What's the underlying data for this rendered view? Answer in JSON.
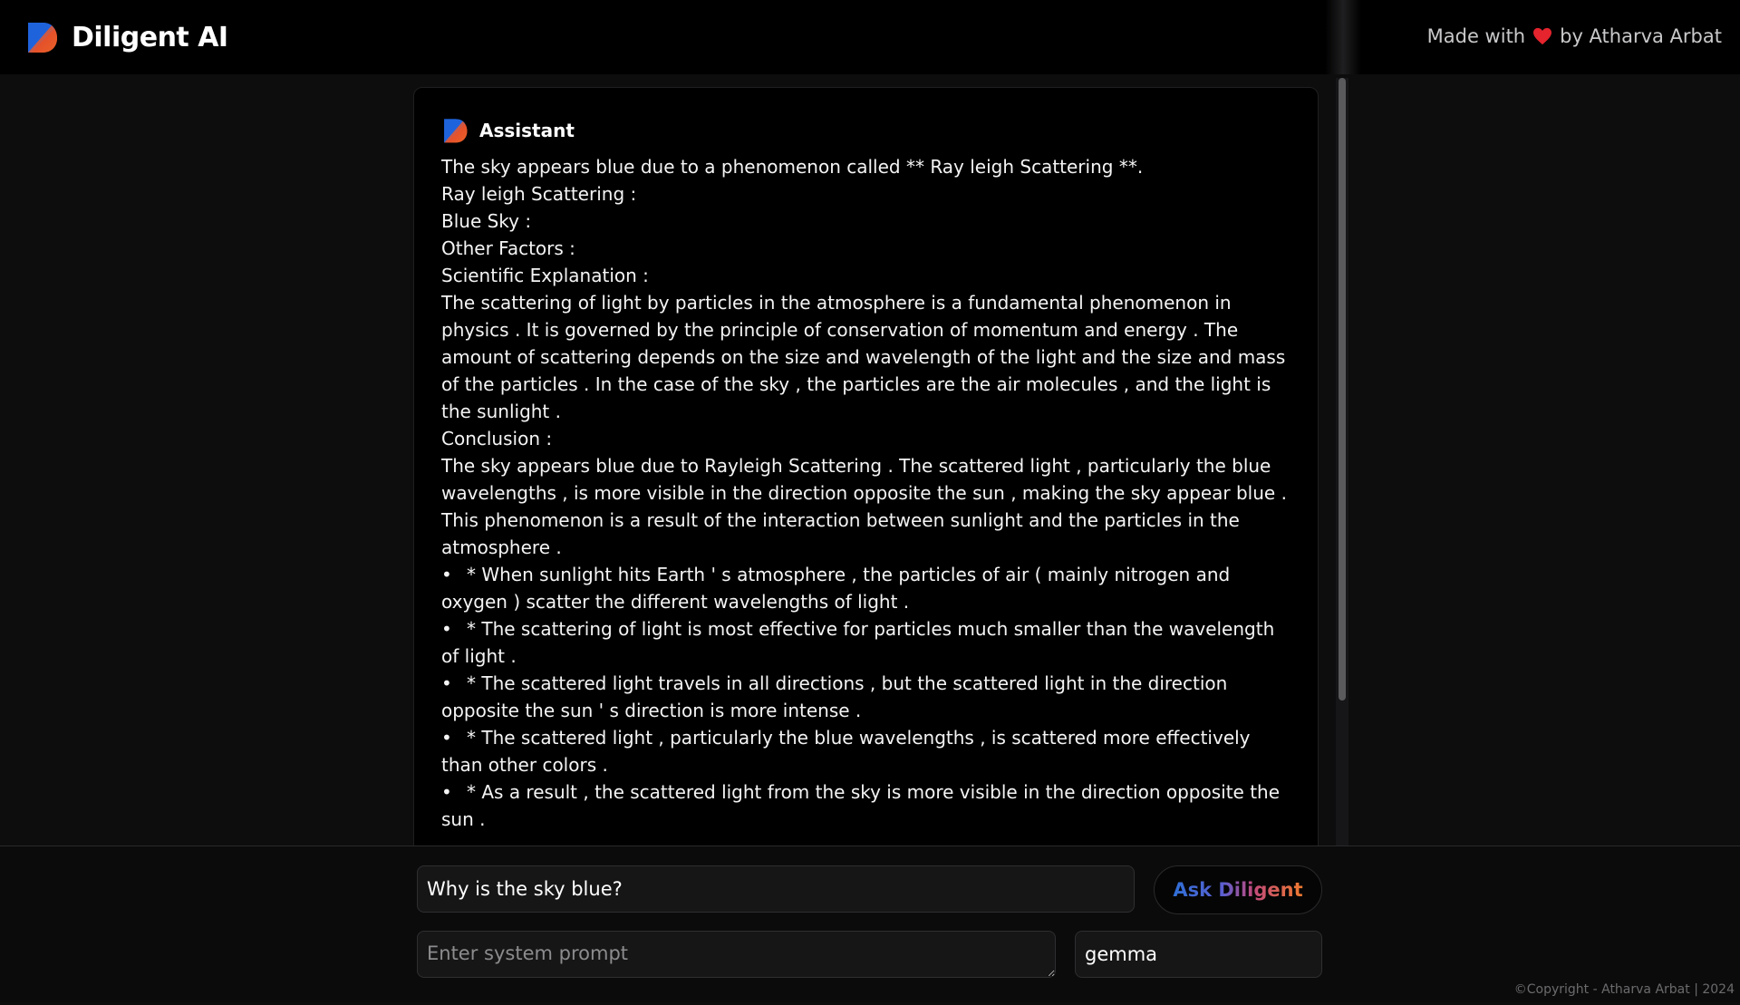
{
  "header": {
    "app_name": "Diligent AI",
    "made_with_prefix": "Made with",
    "made_with_suffix": "by Atharva Arbat",
    "heart_icon": "heart-icon",
    "logo_icon": "diligent-logo-icon"
  },
  "message": {
    "role": "Assistant",
    "paragraphs": [
      "The sky appears blue due to a phenomenon called ** Ray leigh Scattering **.",
      "Ray leigh Scattering :",
      "Blue Sky :",
      "Other Factors :",
      "Scientific Explanation :",
      "The scattering of light by particles in the atmosphere is a fundamental phenomenon in physics . It is governed by the principle of conservation of momentum and energy . The amount of scattering depends on the size and wavelength of the light and the size and mass of the particles . In the case of the sky , the particles are the air molecules , and the light is the sunlight .",
      "Conclusion :",
      "The sky appears blue due to Rayleigh Scattering . The scattered light , particularly the blue wavelengths , is more visible in the direction opposite the sun , making the sky appear blue . This phenomenon is a result of the interaction between sunlight and the particles in the atmosphere ."
    ],
    "bullets": [
      "* When sunlight hits Earth ' s atmosphere , the particles of air ( mainly nitrogen and oxygen ) scatter the different wavelengths of light .",
      "* The scattering of light is most effective for particles much smaller than the wavelength of light .",
      "* The scattered light travels in all directions , but the scattered light in the direction opposite the sun ' s direction is more intense .",
      "* The scattered light , particularly the blue wavelengths , is scattered more effectively than other colors .",
      "* As a result , the scattered light from the sky is more visible in the direction opposite the sun ."
    ]
  },
  "composer": {
    "prompt_value": "Why is the sky blue?",
    "ask_button_label": "Ask Diligent",
    "system_prompt_placeholder": "Enter system prompt",
    "model_value": "gemma"
  },
  "footer": {
    "copyright": "©Copyright - Atharva Arbat | 2024"
  },
  "colors": {
    "background": "#0d0d0e",
    "card": "#000000",
    "input": "#161617",
    "ask_gradient_start": "#2f6fd6",
    "ask_gradient_end": "#f07a2e",
    "heart": "#e5242e"
  }
}
